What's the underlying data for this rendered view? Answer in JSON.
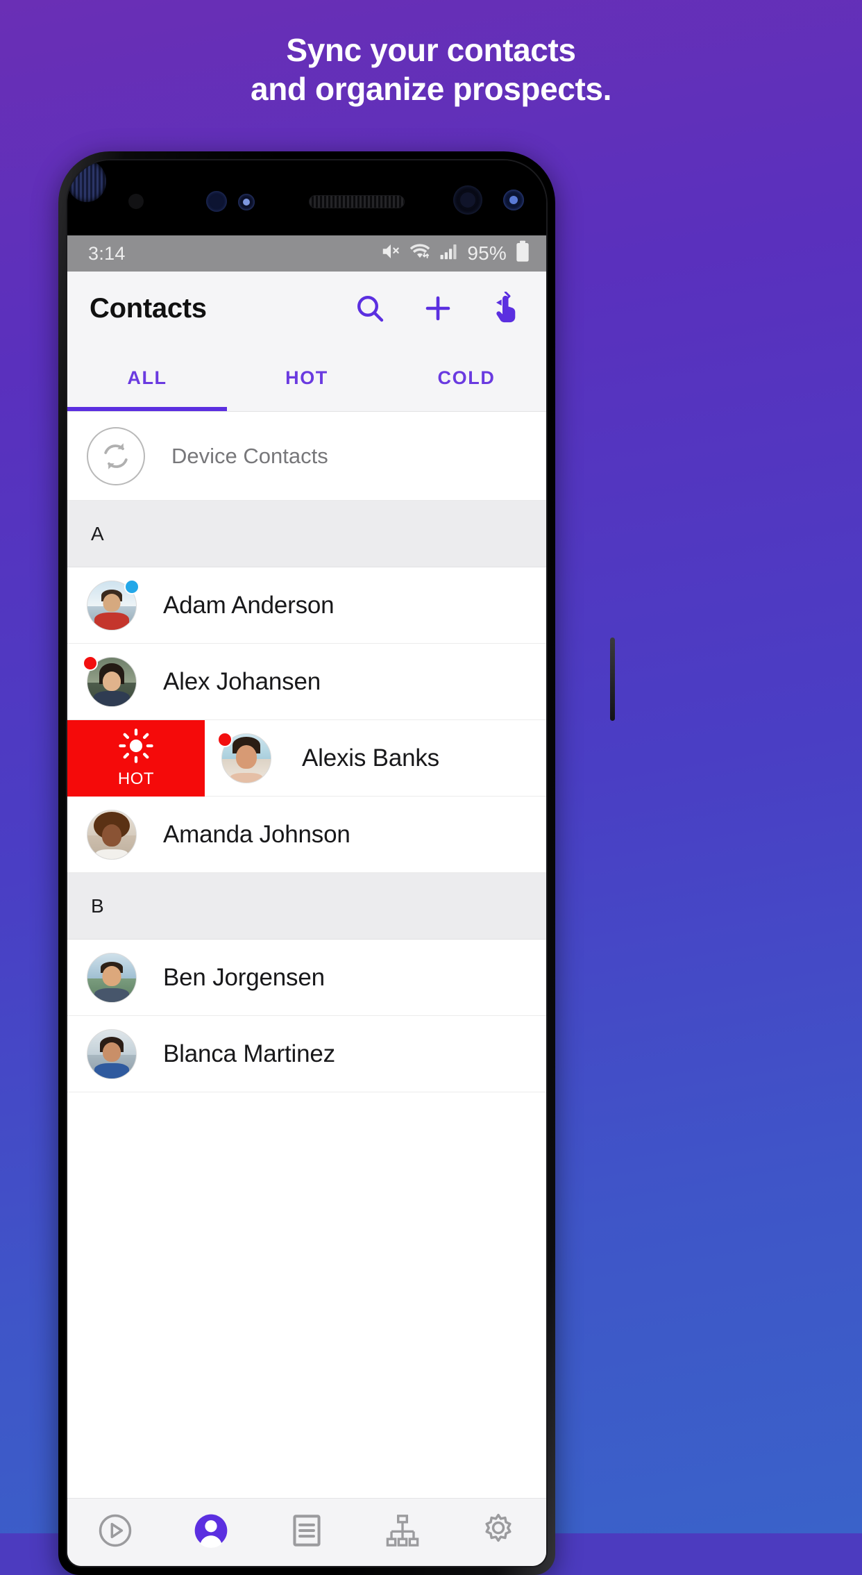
{
  "promo": {
    "headline_line1": "Sync your contacts",
    "headline_line2": "and organize prospects.",
    "background_accent": "#5a30bd"
  },
  "status_bar": {
    "time": "3:14",
    "battery_text": "95%",
    "icons": [
      "mute-icon",
      "wifi-icon",
      "signal-icon",
      "battery-icon"
    ]
  },
  "app_bar": {
    "title": "Contacts",
    "actions": [
      {
        "name": "search-icon",
        "label": "Search"
      },
      {
        "name": "add-icon",
        "label": "Add"
      },
      {
        "name": "swipe-hand-icon",
        "label": "Swipe hint"
      }
    ]
  },
  "tabs": {
    "items": [
      {
        "label": "ALL",
        "active": true
      },
      {
        "label": "HOT",
        "active": false
      },
      {
        "label": "COLD",
        "active": false
      }
    ],
    "active_color": "#5b2fe0"
  },
  "device_contacts": {
    "label": "Device Contacts",
    "icon": "sync-icon"
  },
  "list": {
    "sections": [
      {
        "letter": "A",
        "contacts": [
          {
            "name": "Adam Anderson",
            "badge": "cold",
            "swiped": false
          },
          {
            "name": "Alex Johansen",
            "badge": "hot",
            "swiped": false
          },
          {
            "name": "Alexis Banks",
            "badge": "hot",
            "swiped": true
          },
          {
            "name": "Amanda Johnson",
            "badge": "none",
            "swiped": false
          }
        ]
      },
      {
        "letter": "B",
        "contacts": [
          {
            "name": "Ben Jorgensen",
            "badge": "none",
            "swiped": false
          },
          {
            "name": "Blanca Martinez",
            "badge": "none",
            "swiped": false
          }
        ]
      }
    ]
  },
  "swipe_action": {
    "label": "HOT",
    "icon": "sun-icon",
    "color": "#f50a0a"
  },
  "bottom_nav": {
    "items": [
      {
        "name": "play-circle-icon",
        "active": false
      },
      {
        "name": "person-icon",
        "active": true
      },
      {
        "name": "list-icon",
        "active": false
      },
      {
        "name": "hierarchy-icon",
        "active": false
      },
      {
        "name": "gear-icon",
        "active": false
      }
    ],
    "active_color": "#5b2fe0"
  },
  "colors": {
    "accent_purple": "#5b2fe0",
    "hot_red": "#f50a0a",
    "cold_blue": "#23a7e8"
  }
}
